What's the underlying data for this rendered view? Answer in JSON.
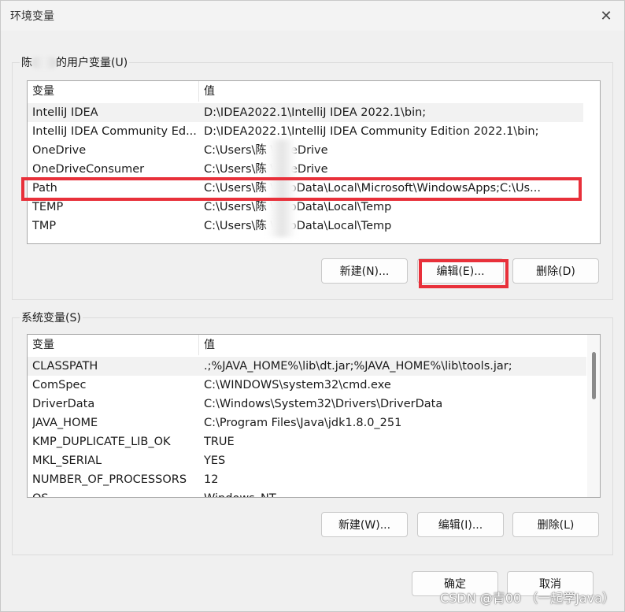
{
  "window": {
    "title": "环境变量",
    "close_glyph": "✕"
  },
  "user_vars": {
    "group_label_prefix": "陈",
    "group_label_suffix": "的用户变量(U)",
    "columns": [
      "变量",
      "值"
    ],
    "rows": [
      {
        "name": "IntelliJ IDEA",
        "value": "D:\\IDEA2022.1\\IntelliJ IDEA 2022.1\\bin;"
      },
      {
        "name": "IntelliJ IDEA Community Ed...",
        "value": "D:\\IDEA2022.1\\IntelliJ IDEA Community Edition 2022.1\\bin;"
      },
      {
        "name": "OneDrive",
        "value": "C:\\Users\\陈    \\OneDrive"
      },
      {
        "name": "OneDriveConsumer",
        "value": "C:\\Users\\陈    \\OneDrive"
      },
      {
        "name": "Path",
        "value": "C:\\Users\\陈    \\AppData\\Local\\Microsoft\\WindowsApps;C:\\Us..."
      },
      {
        "name": "TEMP",
        "value": "C:\\Users\\陈    \\AppData\\Local\\Temp"
      },
      {
        "name": "TMP",
        "value": "C:\\Users\\陈    \\AppData\\Local\\Temp"
      }
    ],
    "buttons": {
      "new": "新建(N)...",
      "edit": "编辑(E)...",
      "delete": "删除(D)"
    }
  },
  "system_vars": {
    "group_label": "系统变量(S)",
    "columns": [
      "变量",
      "值"
    ],
    "rows": [
      {
        "name": "CLASSPATH",
        "value": ".;%JAVA_HOME%\\lib\\dt.jar;%JAVA_HOME%\\lib\\tools.jar;"
      },
      {
        "name": "ComSpec",
        "value": "C:\\WINDOWS\\system32\\cmd.exe"
      },
      {
        "name": "DriverData",
        "value": "C:\\Windows\\System32\\Drivers\\DriverData"
      },
      {
        "name": "JAVA_HOME",
        "value": "C:\\Program Files\\Java\\jdk1.8.0_251"
      },
      {
        "name": "KMP_DUPLICATE_LIB_OK",
        "value": "TRUE"
      },
      {
        "name": "MKL_SERIAL",
        "value": "YES"
      },
      {
        "name": "NUMBER_OF_PROCESSORS",
        "value": "12"
      },
      {
        "name": "OS",
        "value": "Windows_NT"
      }
    ],
    "buttons": {
      "new": "新建(W)...",
      "edit": "编辑(I)...",
      "delete": "删除(L)"
    }
  },
  "footer": {
    "ok": "确定",
    "cancel": "取消"
  },
  "watermark": "CSDN @青00 （一起学Java）",
  "colors": {
    "highlight": "#e8303a",
    "window_bg": "#f0f0f0"
  }
}
